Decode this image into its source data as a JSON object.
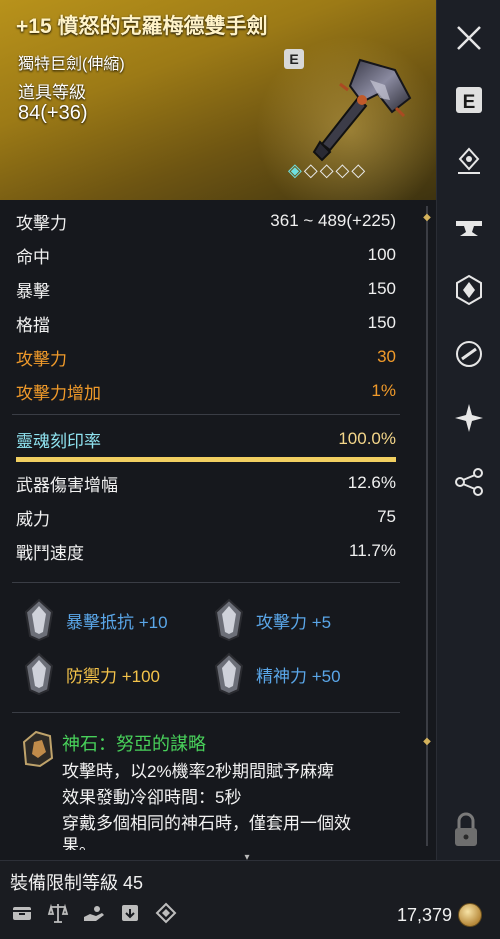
{
  "item": {
    "name": "+15 憤怒的克羅梅德雙手劍",
    "type": "獨特巨劍(伸縮)",
    "level_label": "道具等級",
    "level": "84(+36)",
    "grade_badge": "E",
    "enchant_stars_filled": 1,
    "enchant_stars_total": 5
  },
  "stats": [
    {
      "label": "攻擊力",
      "value": "361 ~ 489(+225)",
      "style": "normal"
    },
    {
      "label": "命中",
      "value": "100",
      "style": "normal"
    },
    {
      "label": "暴擊",
      "value": "150",
      "style": "normal"
    },
    {
      "label": "格擋",
      "value": "150",
      "style": "normal"
    },
    {
      "label": "攻擊力",
      "value": "30",
      "style": "orange"
    },
    {
      "label": "攻擊力增加",
      "value": "1%",
      "style": "orange"
    }
  ],
  "soul": {
    "label": "靈魂刻印率",
    "value": "100.0%",
    "fill_fraction": 1.0
  },
  "weapon_stats": [
    {
      "label": "武器傷害增幅",
      "value": "12.6%"
    },
    {
      "label": "威力",
      "value": "75"
    },
    {
      "label": "戰鬥速度",
      "value": "11.7%"
    }
  ],
  "bonuses": [
    {
      "text": "暴擊抵抗 +10",
      "color": "blue"
    },
    {
      "text": "攻擊力 +5",
      "color": "blue"
    },
    {
      "text": "防禦力 +100",
      "color": "yellow"
    },
    {
      "text": "精神力 +50",
      "color": "blue"
    }
  ],
  "godstone": {
    "title": "神石：努亞的謀略",
    "lines": [
      "攻擊時，以2%機率2秒期間賦予麻痺",
      "效果發動冷卻時間：5秒",
      "穿戴多個相同的神石時，僅套用一個效",
      "果。"
    ]
  },
  "footer": {
    "required_level": "裝備限制等級 45",
    "gold": "17,379"
  },
  "sidebar": {
    "close_label": "×",
    "e_label": "E"
  },
  "colors": {
    "header_gold": "#b8921b",
    "orange": "#f09a2a",
    "soul_cyan": "#8fe3f0",
    "bar_yellow": "#f1cf61",
    "bonus_blue": "#5aa6e8",
    "bonus_yellow": "#f3c24a",
    "godstone_green": "#48d05a"
  }
}
